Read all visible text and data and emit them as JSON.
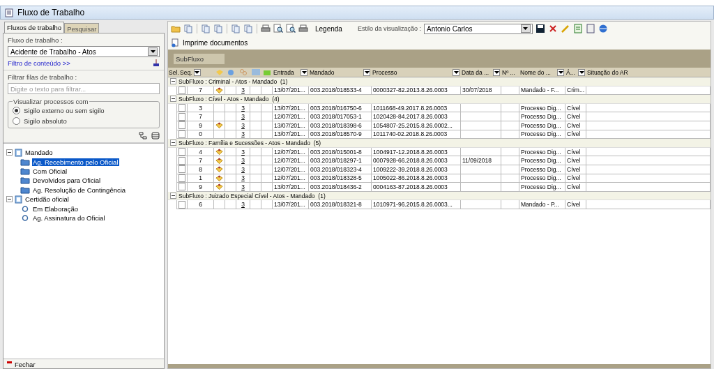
{
  "window": {
    "title": "Fluxo de Trabalho"
  },
  "left_tabs": [
    {
      "label": "Fluxos de trabalho",
      "selected": true
    },
    {
      "label": "Pesquisar",
      "selected": false
    }
  ],
  "workflow": {
    "label": "Fluxo de trabalho :",
    "value": "Acidente de Trabalho - Atos"
  },
  "content_filter_link": "Filtro de conteúdo >>",
  "queue_filter": {
    "label": "Filtrar filas de trabalho :",
    "placeholder": "Digite o texto para filtrar..."
  },
  "visibility": {
    "legend": "Visualizar processos com",
    "options": [
      {
        "label": "Sigilo externo ou sem sigilo",
        "selected": true
      },
      {
        "label": "Sigilo absoluto",
        "selected": false
      }
    ]
  },
  "tree": [
    {
      "label": "Mandado",
      "expanded": true,
      "selected": false,
      "children": [
        {
          "label": "Ag. Recebimento pelo Oficial",
          "selected": true
        },
        {
          "label": "Com Oficial",
          "selected": false
        },
        {
          "label": "Devolvidos para Oficial",
          "selected": false
        },
        {
          "label": "Ag. Resolução de Contingência",
          "selected": false
        }
      ]
    },
    {
      "label": "Certidão oficial",
      "expanded": true,
      "selected": false,
      "children": [
        {
          "label": "Em Elaboração",
          "selected": false
        },
        {
          "label": "Ag. Assinatura do Oficial",
          "selected": false
        }
      ]
    }
  ],
  "close_button": "Fechar",
  "toolbar": {
    "legend": "Legenda",
    "style_label": "Estilo da visualização :",
    "style_value": "Antonio Carlos",
    "print_button": "Imprime documentos"
  },
  "group_chip": "SubFluxo",
  "table": {
    "columns": [
      "Sel.",
      "Seq.",
      "Entrada",
      "Mandado",
      "Processo",
      "Data da ...",
      "Nº ...",
      "Nome do ...",
      "Á...",
      "Situação do AR"
    ],
    "groups": [
      {
        "title": "SubFluxo : Criminal - Atos - Mandado  (1)",
        "rows": [
          {
            "seq": "7",
            "checked": false,
            "flag": true,
            "count": "3",
            "entrada": "13/07/201...",
            "mandado": "003.2018/018533-4",
            "processo": "0000327-82.2013.8.26.0003",
            "data": "30/07/2018",
            "nome": "Mandado - F...",
            "area": "Crim..."
          }
        ]
      },
      {
        "title": "SubFluxo : Cível - Atos - Mandado  (4)",
        "rows": [
          {
            "seq": "3",
            "checked": false,
            "flag": false,
            "count": "3",
            "entrada": "13/07/201...",
            "mandado": "003.2018/016750-6",
            "processo": "1011668-49.2017.8.26.0003",
            "data": "",
            "nome": "Processo Dig...",
            "area": "Cível"
          },
          {
            "seq": "7",
            "checked": false,
            "flag": false,
            "count": "3",
            "entrada": "12/07/201...",
            "mandado": "003.2018/017053-1",
            "processo": "1020428-84.2017.8.26.0003",
            "data": "",
            "nome": "Processo Dig...",
            "area": "Cível"
          },
          {
            "seq": "9",
            "checked": false,
            "flag": true,
            "count": "3",
            "entrada": "13/07/201...",
            "mandado": "003.2018/018398-6",
            "processo": "1054807-25.2015.8.26.0002...",
            "data": "",
            "nome": "Processo Dig...",
            "area": "Cível"
          },
          {
            "seq": "0",
            "checked": false,
            "flag": false,
            "count": "3",
            "entrada": "13/07/201...",
            "mandado": "003.2018/018570-9",
            "processo": "1011740-02.2018.8.26.0003",
            "data": "",
            "nome": "Processo Dig...",
            "area": "Cível"
          }
        ]
      },
      {
        "title": "SubFluxo : Família e Sucessões - Atos - Mandado  (5)",
        "rows": [
          {
            "seq": "4",
            "checked": false,
            "flag": true,
            "count": "3",
            "entrada": "12/07/201...",
            "mandado": "003.2018/015001-8",
            "processo": "1004917-12.2018.8.26.0003",
            "data": "",
            "nome": "Processo Dig...",
            "area": "Cível"
          },
          {
            "seq": "7",
            "checked": false,
            "flag": true,
            "count": "3",
            "entrada": "12/07/201...",
            "mandado": "003.2018/018297-1",
            "processo": "0007928-66.2018.8.26.0003",
            "data": "11/09/2018",
            "nome": "Processo Dig...",
            "area": "Cível"
          },
          {
            "seq": "8",
            "checked": false,
            "flag": true,
            "count": "3",
            "entrada": "12/07/201...",
            "mandado": "003.2018/018323-4",
            "processo": "1009222-39.2018.8.26.0003",
            "data": "",
            "nome": "Processo Dig...",
            "area": "Cível"
          },
          {
            "seq": "1",
            "checked": false,
            "flag": true,
            "count": "3",
            "entrada": "12/07/201...",
            "mandado": "003.2018/018328-5",
            "processo": "1005022-86.2018.8.26.0003",
            "data": "",
            "nome": "Processo Dig...",
            "area": "Cível"
          },
          {
            "seq": "9",
            "checked": false,
            "flag": true,
            "count": "3",
            "entrada": "13/07/201...",
            "mandado": "003.2018/018436-2",
            "processo": "0004163-87.2018.8.26.0003",
            "data": "",
            "nome": "Processo Dig...",
            "area": "Cível"
          }
        ]
      },
      {
        "title": "SubFluxo : Juizado Especial Cível - Atos - Mandado  (1)",
        "rows": [
          {
            "seq": "6",
            "checked": false,
            "flag": false,
            "count": "3",
            "entrada": "13/07/201...",
            "mandado": "003.2018/018321-8",
            "processo": "1010971-96.2015.8.26.0003...",
            "data": "",
            "nome": "Mandado - P...",
            "area": "Cível"
          }
        ]
      }
    ]
  }
}
